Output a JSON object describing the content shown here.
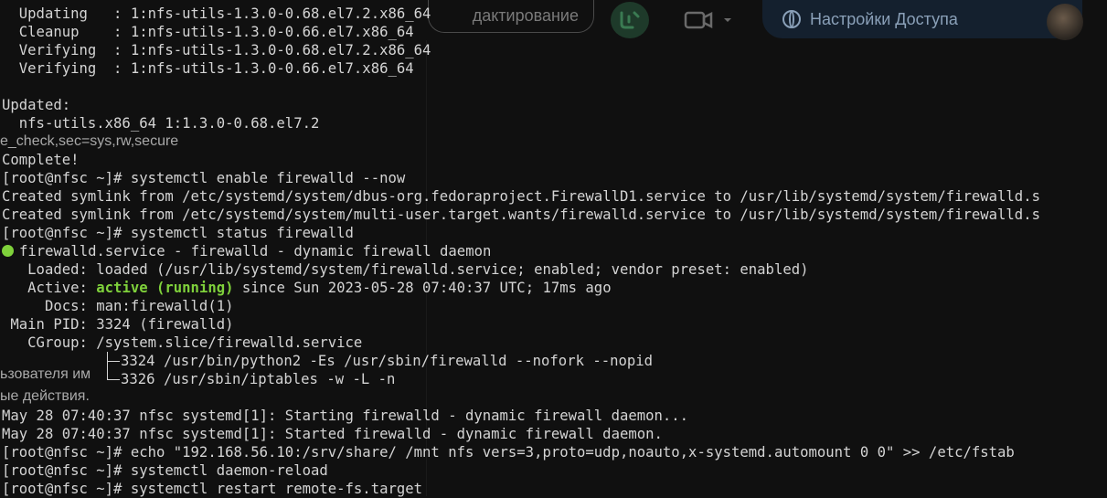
{
  "background_page": {
    "edit_button_label": "дактирование",
    "access_button_label": "Настройки Доступа",
    "ghost_text_1": "e_check,sec=sys,rw,secure",
    "ghost_text_2": "ьзователя им",
    "ghost_text_3": "ые действия."
  },
  "terminal": {
    "lines": [
      "  Updating   : 1:nfs-utils-1.3.0-0.68.el7.2.x86_64",
      "  Cleanup    : 1:nfs-utils-1.3.0-0.66.el7.x86_64",
      "  Verifying  : 1:nfs-utils-1.3.0-0.68.el7.2.x86_64",
      "  Verifying  : 1:nfs-utils-1.3.0-0.66.el7.x86_64",
      "",
      "Updated:",
      "  nfs-utils.x86_64 1:1.3.0-0.68.el7.2",
      "",
      "Complete!",
      "[root@nfsc ~]# systemctl enable firewalld --now",
      "Created symlink from /etc/systemd/system/dbus-org.fedoraproject.FirewallD1.service to /usr/lib/systemd/system/firewalld.s",
      "Created symlink from /etc/systemd/system/multi-user.target.wants/firewalld.service to /usr/lib/systemd/system/firewalld.s",
      "[root@nfsc ~]# systemctl status firewalld"
    ],
    "status_header": "firewalld.service - firewalld - dynamic firewall daemon",
    "loaded_line": "   Loaded: loaded (/usr/lib/systemd/system/firewalld.service; enabled; vendor preset: enabled)",
    "active_prefix": "   Active: ",
    "active_state": "active (running)",
    "active_suffix": " since Sun 2023-05-28 07:40:37 UTC; 17ms ago",
    "docs_line": "     Docs: man:firewalld(1)",
    "mainpid_line": " Main PID: 3324 (firewalld)",
    "cgroup_line": "   CGroup: /system.slice/firewalld.service",
    "cgroup_child_1": "3324 /usr/bin/python2 -Es /usr/sbin/firewalld --nofork --nopid",
    "cgroup_child_2": "3326 /usr/sbin/iptables -w -L -n",
    "tail_lines": [
      "May 28 07:40:37 nfsc systemd[1]: Starting firewalld - dynamic firewall daemon...",
      "May 28 07:40:37 nfsc systemd[1]: Started firewalld - dynamic firewall daemon.",
      "[root@nfsc ~]# echo \"192.168.56.10:/srv/share/ /mnt nfs vers=3,proto=udp,noauto,x-systemd.automount 0 0\" >> /etc/fstab",
      "[root@nfsc ~]# systemctl daemon-reload",
      "[root@nfsc ~]# systemctl restart remote-fs.target"
    ]
  },
  "colors": {
    "background": "#101010",
    "text": "#d4d4d4",
    "active_green": "#7fd13b"
  }
}
